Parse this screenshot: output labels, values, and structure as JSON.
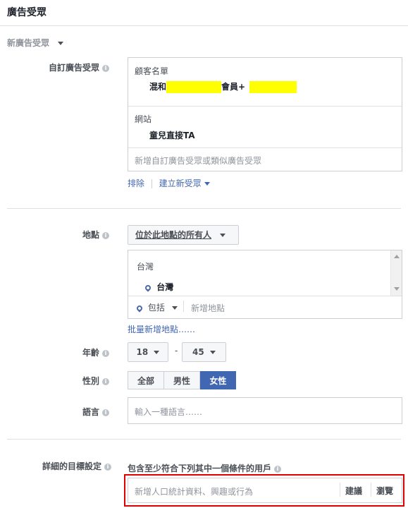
{
  "header": {
    "title": "廣告受眾"
  },
  "new_audience": {
    "label": "新廣告受眾"
  },
  "custom_audience": {
    "label": "自訂廣告受眾",
    "groups": [
      {
        "title": "顧客名單",
        "item_prefix": "混和",
        "item_middle": "會員+"
      },
      {
        "title": "網站",
        "item": "童兒直接TA"
      }
    ],
    "placeholder": "新增自訂廣告受眾或類似廣告受眾",
    "exclude_link": "排除",
    "create_link": "建立新受眾"
  },
  "location": {
    "label": "地點",
    "dropdown_value": "位於此地點的所有人",
    "country_group": "台灣",
    "country_item": "台灣",
    "include_label": "包括",
    "add_placeholder": "新增地點",
    "bulk_link": "批量新增地點……"
  },
  "age": {
    "label": "年齡",
    "min": "18",
    "dash": "-",
    "max": "45"
  },
  "gender": {
    "label": "性別",
    "options": [
      "全部",
      "男性",
      "女性"
    ],
    "selected": "女性"
  },
  "language": {
    "label": "語言",
    "placeholder": "輸入一種語言……"
  },
  "detailed_targeting": {
    "label": "詳細的目標設定",
    "description": "包含至少符合下列其中一個條件的用戶",
    "placeholder": "新增人口統計資料、興趣或行為",
    "suggest_link": "建議",
    "browse_link": "瀏覽"
  },
  "colors": {
    "accent": "#4267b2",
    "highlight": "#ffff00",
    "annotation_red": "#e00000"
  }
}
